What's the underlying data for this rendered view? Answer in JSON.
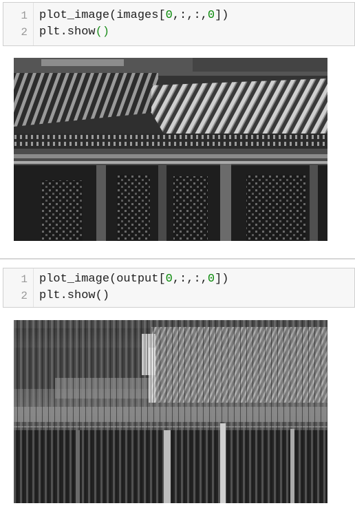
{
  "cells": [
    {
      "line_numbers": [
        "1",
        "2"
      ],
      "line1": {
        "fn": "plot_image(",
        "var": "images",
        "open": "[",
        "a": "0",
        "s1": ",:,:,",
        "b": "0",
        "close": "])"
      },
      "line2": {
        "fn": "plt.show",
        "parens": "()"
      },
      "output": {
        "icon": "image-icon",
        "content": "grayscale palace roof photo"
      }
    },
    {
      "line_numbers": [
        "1",
        "2"
      ],
      "line1": {
        "fn": "plot_image(",
        "var": "output",
        "open": "[",
        "a": "0",
        "s1": ",:,:,",
        "b": "0",
        "close": "])"
      },
      "line2": {
        "fn": "plt.show",
        "parens": "()"
      },
      "output": {
        "icon": "image-icon",
        "content": "blurred convolution output"
      }
    }
  ],
  "colors": {
    "number": "#0a8a0a",
    "paren": "#1f8f1f",
    "linenumber": "#999999",
    "codebg": "#f7f7f7"
  }
}
